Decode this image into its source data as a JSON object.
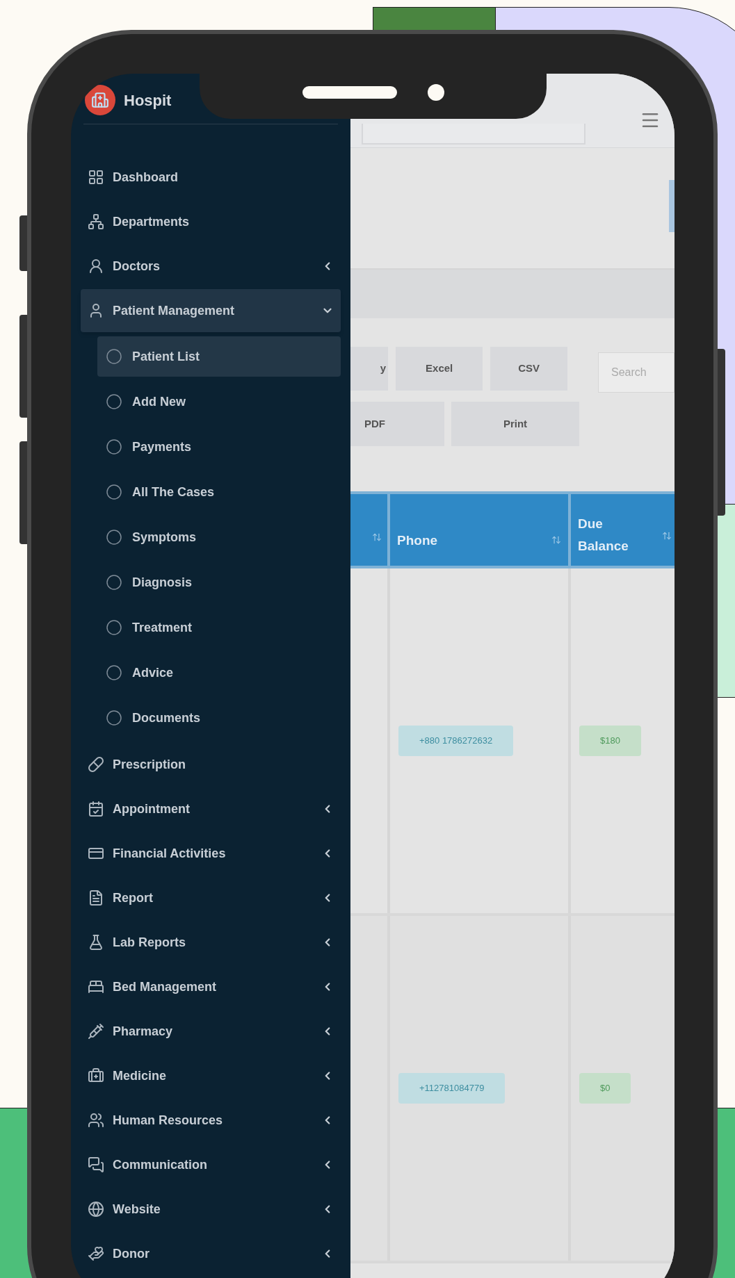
{
  "sidebar": {
    "brand": "Hospit",
    "items": [
      {
        "kind": "link",
        "label": "Dashboard"
      },
      {
        "kind": "link",
        "label": "Departments"
      },
      {
        "kind": "group",
        "label": "Doctors",
        "expanded": false
      },
      {
        "kind": "group",
        "label": "Patient Management",
        "expanded": true,
        "children": [
          {
            "label": "Patient List",
            "selected": true
          },
          {
            "label": "Add New",
            "selected": false
          },
          {
            "label": "Payments",
            "selected": false
          },
          {
            "label": "All The Cases",
            "selected": false
          },
          {
            "label": "Symptoms",
            "selected": false
          },
          {
            "label": "Diagnosis",
            "selected": false
          },
          {
            "label": "Treatment",
            "selected": false
          },
          {
            "label": "Advice",
            "selected": false
          },
          {
            "label": "Documents",
            "selected": false
          }
        ]
      },
      {
        "kind": "link",
        "label": "Prescription"
      },
      {
        "kind": "group",
        "label": "Appointment",
        "expanded": false
      },
      {
        "kind": "group",
        "label": "Financial Activities",
        "expanded": false
      },
      {
        "kind": "group",
        "label": "Report",
        "expanded": false
      },
      {
        "kind": "group",
        "label": "Lab Reports",
        "expanded": false
      },
      {
        "kind": "group",
        "label": "Bed Management",
        "expanded": false
      },
      {
        "kind": "group",
        "label": "Pharmacy",
        "expanded": false
      },
      {
        "kind": "group",
        "label": "Medicine",
        "expanded": false
      },
      {
        "kind": "group",
        "label": "Human Resources",
        "expanded": false
      },
      {
        "kind": "group",
        "label": "Communication",
        "expanded": false
      },
      {
        "kind": "group",
        "label": "Website",
        "expanded": false
      },
      {
        "kind": "group",
        "label": "Donor",
        "expanded": false
      }
    ]
  },
  "export_buttons": [
    "y",
    "Excel",
    "CSV",
    "PDF",
    "Print"
  ],
  "table_search": {
    "placeholder": "Search"
  },
  "table": {
    "columns": [
      "Phone",
      "Due Balance"
    ],
    "rows": [
      {
        "phone": "+880 1786272632",
        "due_balance": "$180"
      },
      {
        "phone": "+112781084779",
        "due_balance": "$0"
      }
    ]
  }
}
